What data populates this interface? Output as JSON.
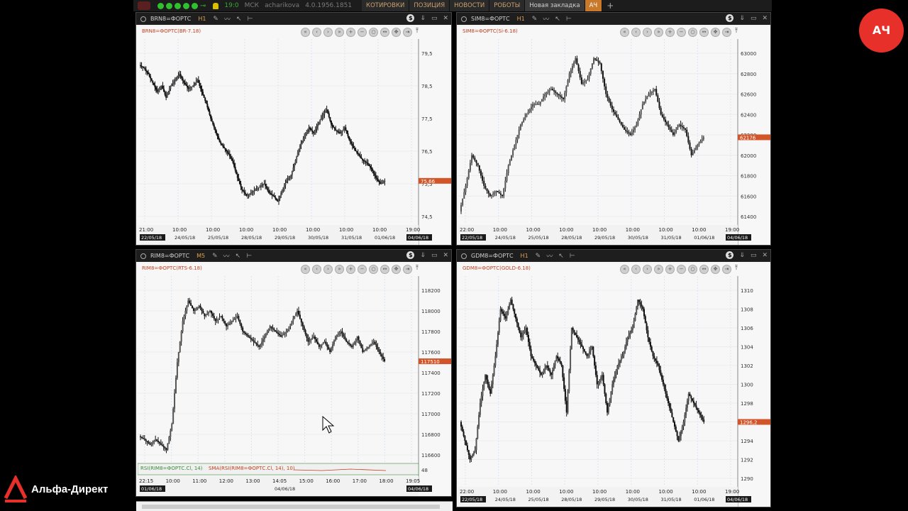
{
  "topbar": {
    "time": "19:0",
    "timezone": "МСК",
    "user": "acharikova",
    "version": "4.0.1956.1851",
    "tabs": [
      "КОТИРОВКИ",
      "ПОЗИЦИЯ",
      "НОВОСТИ",
      "РОБОТЫ",
      "Новая закладка",
      "АЧ"
    ]
  },
  "avatar": {
    "initials": "АЧ"
  },
  "brand": {
    "name": "Альфа-Директ"
  },
  "colors": {
    "candle": "#111111",
    "price_tag": "#d2552a",
    "grid": "#d8e6f3",
    "label": "#c04020"
  },
  "panels": [
    {
      "symbol": "BRN8=ФОРТС",
      "timeframe": "H1",
      "label": "BRN8=ФОРТС(BR-7.18)",
      "price_tag": "75,66",
      "y_ticks": [
        "79,5",
        "78,5",
        "77,5",
        "76,5",
        "75,5",
        "74,5"
      ],
      "x_ticks": [
        "21:00",
        "10:00",
        "10:00",
        "10:00",
        "10:00",
        "10:00",
        "10:00",
        "10:00",
        "19:00"
      ],
      "date_ticks": [
        "22/05/18",
        "24/05/18",
        "25/05/18",
        "28/05/18",
        "29/05/18",
        "30/05/18",
        "31/05/18",
        "01/06/18",
        "04/06/18"
      ]
    },
    {
      "symbol": "SIM8=ФОРТС",
      "timeframe": "H1",
      "label": "SIM8=ФОРТС(Si-6.18)",
      "price_tag": "62176",
      "y_ticks": [
        "63000",
        "62800",
        "62600",
        "62400",
        "62200",
        "62000",
        "61800",
        "61600",
        "61400"
      ],
      "x_ticks": [
        "22:00",
        "10:00",
        "10:00",
        "10:00",
        "10:00",
        "10:00",
        "10:00",
        "10:00",
        "19:00"
      ],
      "date_ticks": [
        "22/05/18",
        "24/05/18",
        "25/05/18",
        "28/05/18",
        "29/05/18",
        "30/05/18",
        "31/05/18",
        "01/06/18",
        "04/06/18"
      ]
    },
    {
      "symbol": "RIM8=ФОРТС",
      "timeframe": "M5",
      "label": "RIM8=ФОРТС(RTS-6.18)",
      "price_tag": "117510",
      "y_ticks": [
        "118200",
        "118000",
        "117800",
        "117600",
        "117400",
        "117200",
        "117000",
        "116800",
        "116600"
      ],
      "x_ticks": [
        "22:15",
        "10:00",
        "11:00",
        "12:00",
        "13:00",
        "14:05",
        "15:00",
        "16:00",
        "17:00",
        "18:00",
        "19:05"
      ],
      "date_ticks": [
        "01/06/18",
        "04/06/18",
        "04/06/18"
      ],
      "rsi_label": "RSI(RIM8=ФОРТС.Cl, 14)",
      "sma_label": "SMA(RSI(RIM8=ФОРТС.Cl, 14), 10)",
      "rsi_tick": "48"
    },
    {
      "symbol": "GDM8=ФОРТС",
      "timeframe": "H1",
      "label": "GDM8=ФОРТС(GOLD-6.18)",
      "price_tag": "1296,2",
      "y_ticks": [
        "1310",
        "1308",
        "1306",
        "1304",
        "1302",
        "1300",
        "1298",
        "1296",
        "1294",
        "1292",
        "1290"
      ],
      "x_ticks": [
        "22:00",
        "10:00",
        "10:00",
        "10:00",
        "10:00",
        "10:00",
        "10:00",
        "10:00",
        "19:00"
      ],
      "date_ticks": [
        "22/05/18",
        "24/05/18",
        "25/05/18",
        "28/05/18",
        "29/05/18",
        "30/05/18",
        "31/05/18",
        "01/06/18",
        "04/06/18"
      ]
    }
  ]
}
